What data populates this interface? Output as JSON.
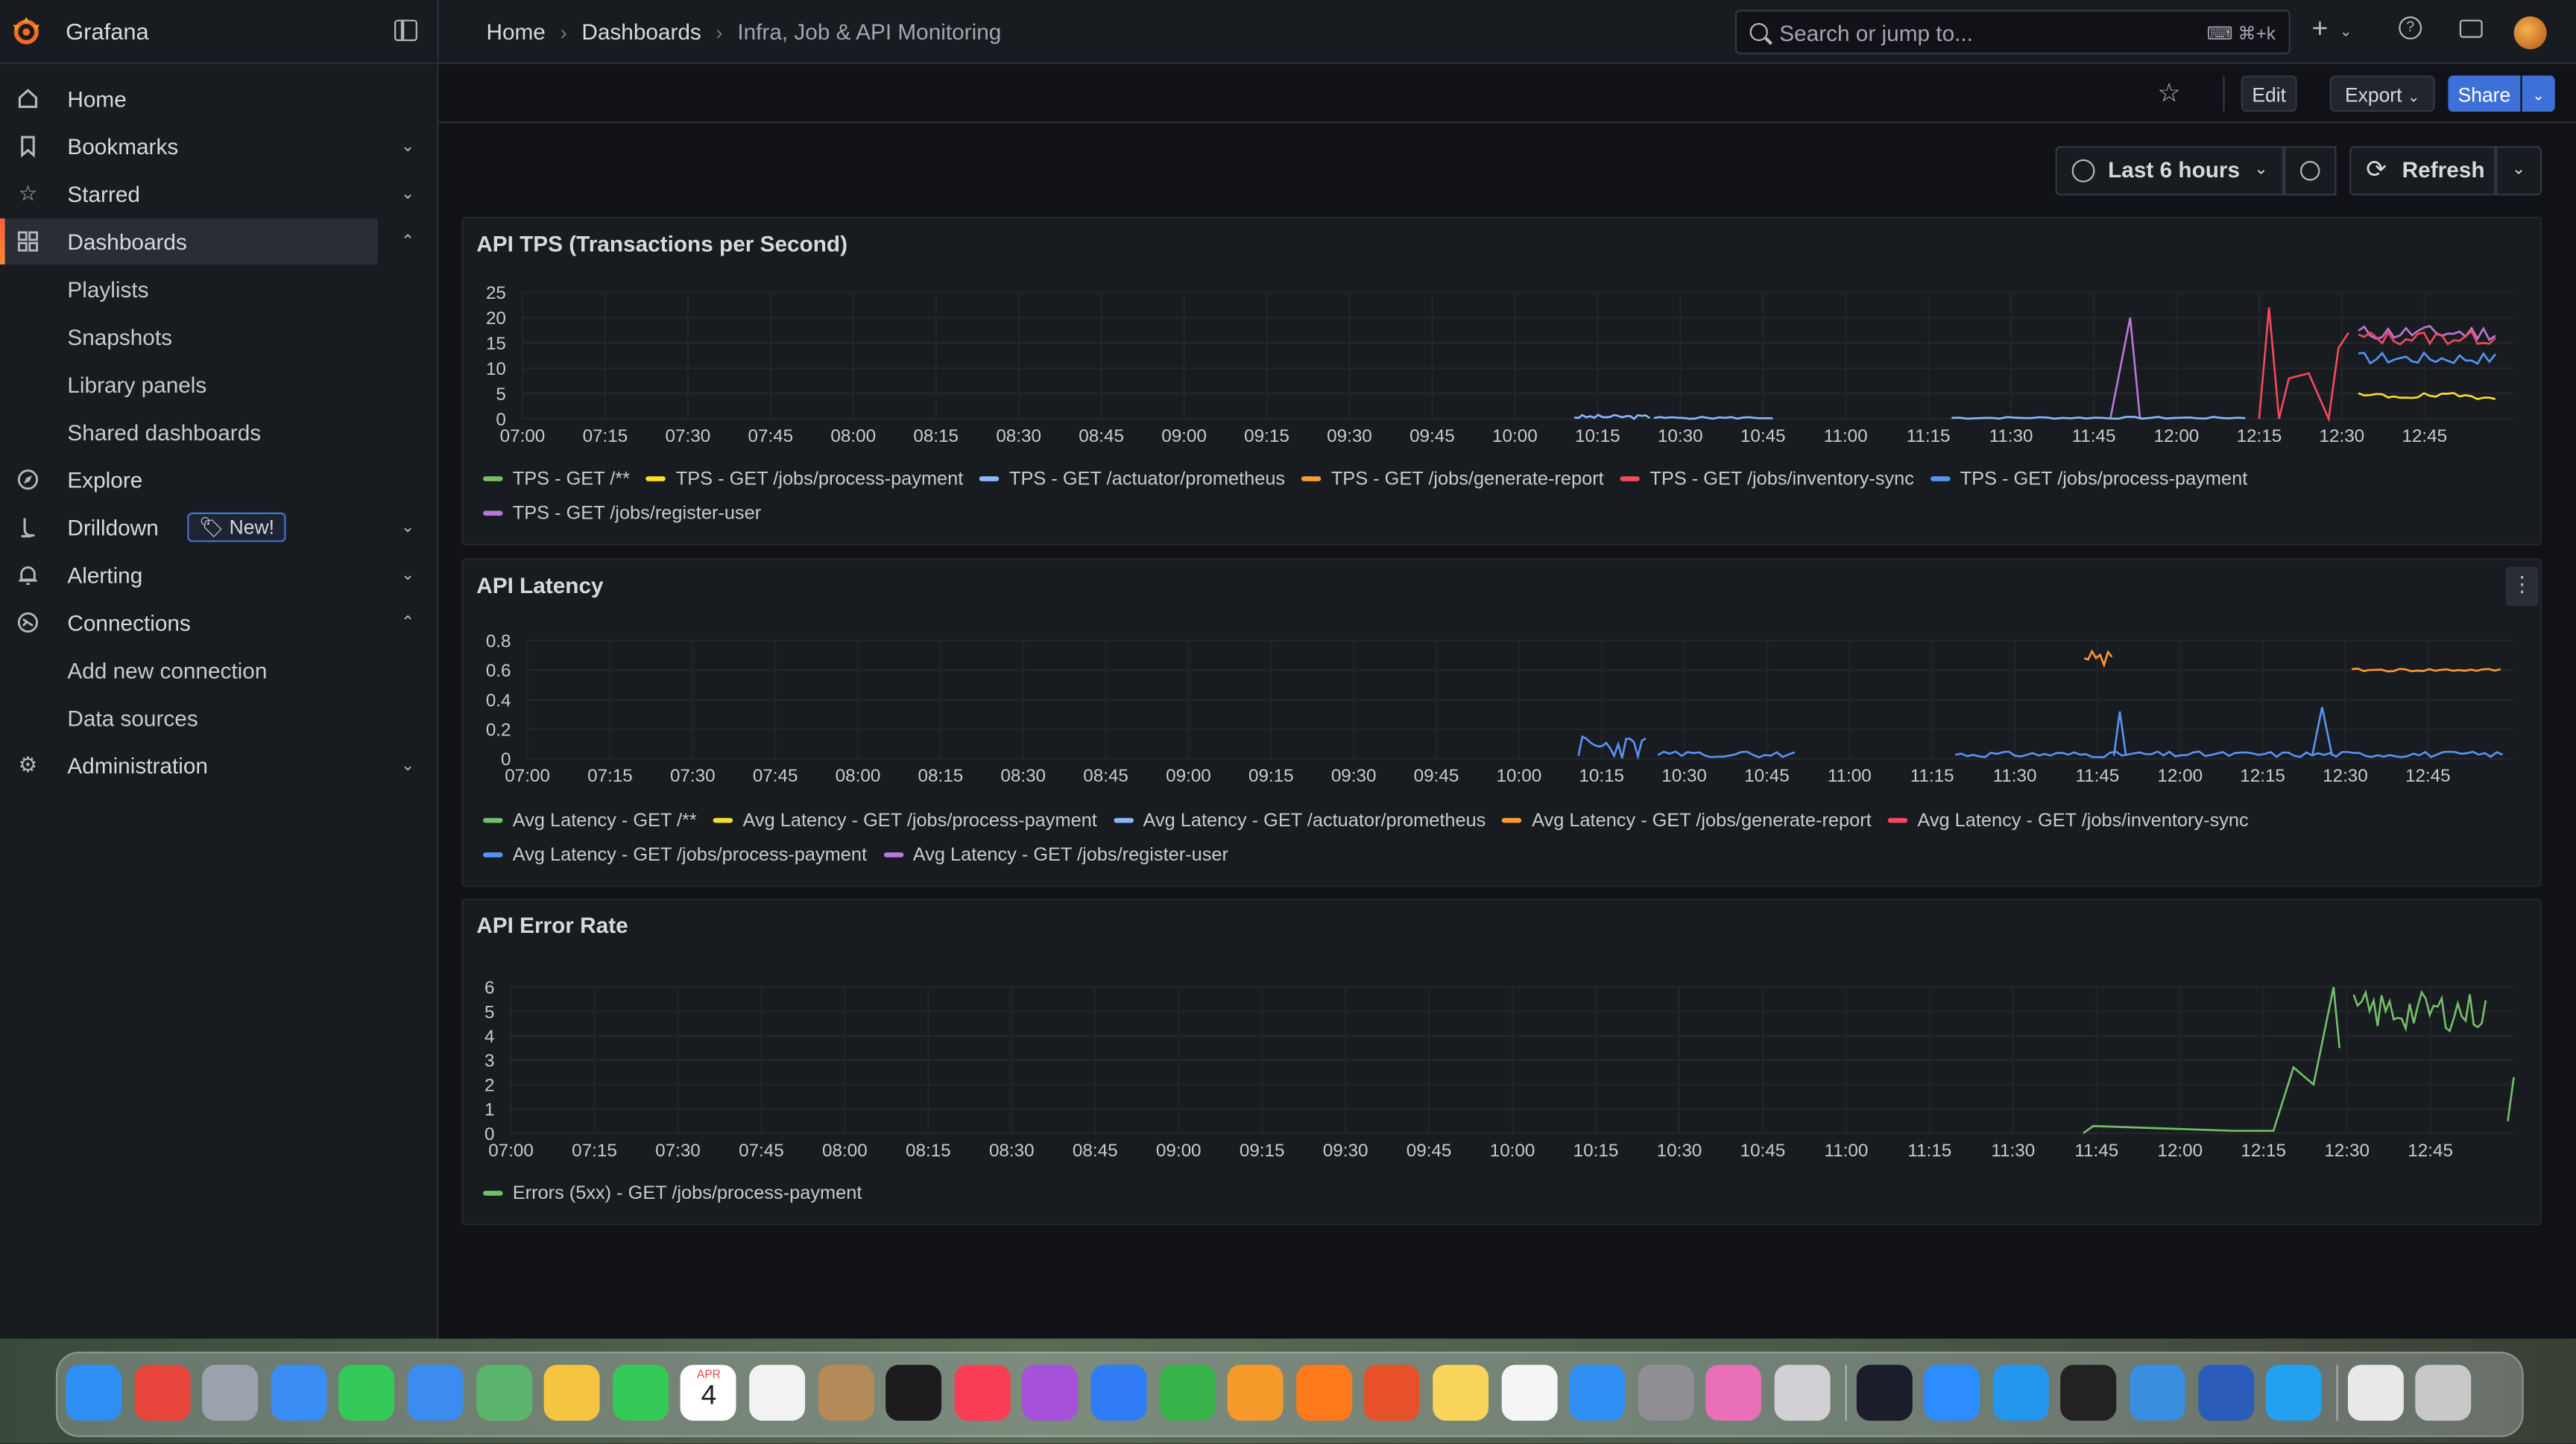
{
  "topbar": {
    "brand": "Grafana",
    "breadcrumbs": [
      "Home",
      "Dashboards",
      "Infra, Job & API Monitoring"
    ],
    "search_placeholder": "Search or jump to...",
    "search_shortcut": "⌘+k"
  },
  "sidebar": {
    "items": [
      {
        "label": "Home",
        "icon": "home-icon"
      },
      {
        "label": "Bookmarks",
        "icon": "bookmark-icon"
      },
      {
        "label": "Starred",
        "icon": "star-icon"
      },
      {
        "label": "Dashboards",
        "icon": "dashboards-icon"
      },
      {
        "label": "Playlists"
      },
      {
        "label": "Snapshots"
      },
      {
        "label": "Library panels"
      },
      {
        "label": "Shared dashboards"
      },
      {
        "label": "Explore",
        "icon": "compass-icon"
      },
      {
        "label": "Drilldown",
        "icon": "drilldown-icon",
        "badge": "New!"
      },
      {
        "label": "Alerting",
        "icon": "bell-icon"
      },
      {
        "label": "Connections",
        "icon": "connections-icon"
      },
      {
        "label": "Add new connection"
      },
      {
        "label": "Data sources"
      },
      {
        "label": "Administration",
        "icon": "gear-icon"
      }
    ]
  },
  "toolbar": {
    "edit": "Edit",
    "export": "Export",
    "share": "Share",
    "time_range": "Last 6 hours",
    "refresh": "Refresh"
  },
  "x_ticks": [
    "07:00",
    "07:15",
    "07:30",
    "07:45",
    "08:00",
    "08:15",
    "08:30",
    "08:45",
    "09:00",
    "09:15",
    "09:30",
    "09:45",
    "10:00",
    "10:15",
    "10:30",
    "10:45",
    "11:00",
    "11:15",
    "11:30",
    "11:45",
    "12:00",
    "12:15",
    "12:30",
    "12:45"
  ],
  "panels": [
    {
      "title": "API TPS (Transactions per Second)",
      "y_ticks": [
        "25",
        "20",
        "15",
        "10",
        "5",
        "0"
      ],
      "legend": [
        {
          "label": "TPS - GET /**",
          "color": "#73bf69"
        },
        {
          "label": "TPS - GET /jobs/process-payment",
          "color": "#fade2a"
        },
        {
          "label": "TPS - GET /actuator/prometheus",
          "color": "#8ab8ff"
        },
        {
          "label": "TPS - GET /jobs/generate-report",
          "color": "#ff9830"
        },
        {
          "label": "TPS - GET /jobs/inventory-sync",
          "color": "#f2495c"
        },
        {
          "label": "TPS - GET /jobs/process-payment",
          "color": "#5794f2"
        },
        {
          "label": "TPS - GET /jobs/register-user",
          "color": "#b877d9"
        }
      ]
    },
    {
      "title": "API Latency",
      "y_ticks": [
        "0.8",
        "0.6",
        "0.4",
        "0.2",
        "0"
      ],
      "legend": [
        {
          "label": "Avg Latency - GET /**",
          "color": "#73bf69"
        },
        {
          "label": "Avg Latency - GET /jobs/process-payment",
          "color": "#fade2a"
        },
        {
          "label": "Avg Latency - GET /actuator/prometheus",
          "color": "#8ab8ff"
        },
        {
          "label": "Avg Latency - GET /jobs/generate-report",
          "color": "#ff9830"
        },
        {
          "label": "Avg Latency - GET /jobs/inventory-sync",
          "color": "#f2495c"
        },
        {
          "label": "Avg Latency - GET /jobs/process-payment",
          "color": "#5794f2"
        },
        {
          "label": "Avg Latency - GET /jobs/register-user",
          "color": "#b877d9"
        }
      ]
    },
    {
      "title": "API Error Rate",
      "y_ticks": [
        "6",
        "5",
        "4",
        "3",
        "2",
        "1",
        "0"
      ],
      "legend": [
        {
          "label": "Errors (5xx) - GET /jobs/process-payment",
          "color": "#73bf69"
        }
      ]
    }
  ],
  "dock": {
    "calendar_month": "APR",
    "calendar_day": "4",
    "apps": [
      "finder",
      "chrome",
      "launchpad",
      "safari",
      "messages",
      "mail",
      "maps",
      "photos",
      "facetime",
      "calendar",
      "reminders",
      "contacts",
      "tv",
      "music",
      "podcasts",
      "keynote",
      "numbers",
      "pages",
      "firefox",
      "firefox-dev",
      "notes",
      "freeform",
      "app-store",
      "system-settings",
      "copilot",
      "iphone-mirroring",
      "intellij",
      "zoom",
      "docker",
      "terminal",
      "xcode",
      "word",
      "vscode",
      "files",
      "trash"
    ]
  }
}
